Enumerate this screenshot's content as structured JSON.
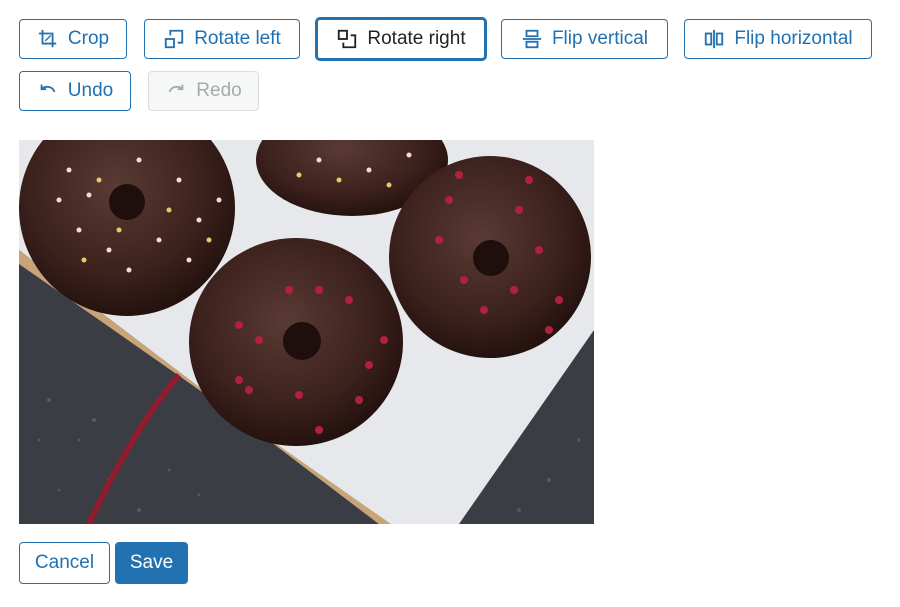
{
  "toolbar": {
    "crop_label": "Crop",
    "rotate_left_label": "Rotate left",
    "rotate_right_label": "Rotate right",
    "flip_vertical_label": "Flip vertical",
    "flip_horizontal_label": "Flip horizontal",
    "undo_label": "Undo",
    "redo_label": "Redo"
  },
  "footer": {
    "cancel_label": "Cancel",
    "save_label": "Save"
  },
  "icons": [
    "crop-icon",
    "rotate-left-icon",
    "rotate-right-icon",
    "flip-vertical-icon",
    "flip-horizontal-icon",
    "undo-icon",
    "redo-icon"
  ],
  "colors": {
    "accent": "#2271b1",
    "disabled": "#a7aaad",
    "icing": "#3b201c",
    "raspberry": "#b3203a",
    "surface": "#3a3d44"
  }
}
